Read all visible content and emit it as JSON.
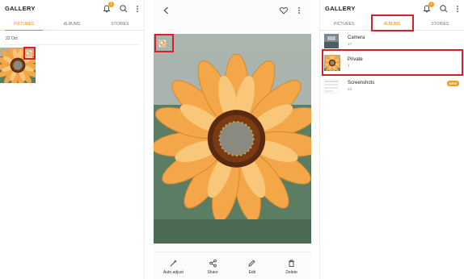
{
  "gallery": {
    "title": "GALLERY",
    "notification_count": "1",
    "tabs": [
      "PICTURES",
      "ALBUMS",
      "STORIES"
    ]
  },
  "pictures_view": {
    "date_header": "22 Oct"
  },
  "viewer": {
    "actions": [
      {
        "label": "Auto adjust",
        "icon": "magic-wand-icon"
      },
      {
        "label": "Share",
        "icon": "share-icon"
      },
      {
        "label": "Edit",
        "icon": "pencil-icon"
      },
      {
        "label": "Delete",
        "icon": "trash-icon"
      }
    ]
  },
  "albums_view": {
    "albums": [
      {
        "name": "Camera",
        "count": "17"
      },
      {
        "name": "Private",
        "count": "1"
      },
      {
        "name": "Screenshots",
        "count": "24",
        "badge": "NEW"
      }
    ]
  },
  "colors": {
    "accent": "#e58a00",
    "highlight": "#d9202a",
    "badge": "#f0a020"
  }
}
